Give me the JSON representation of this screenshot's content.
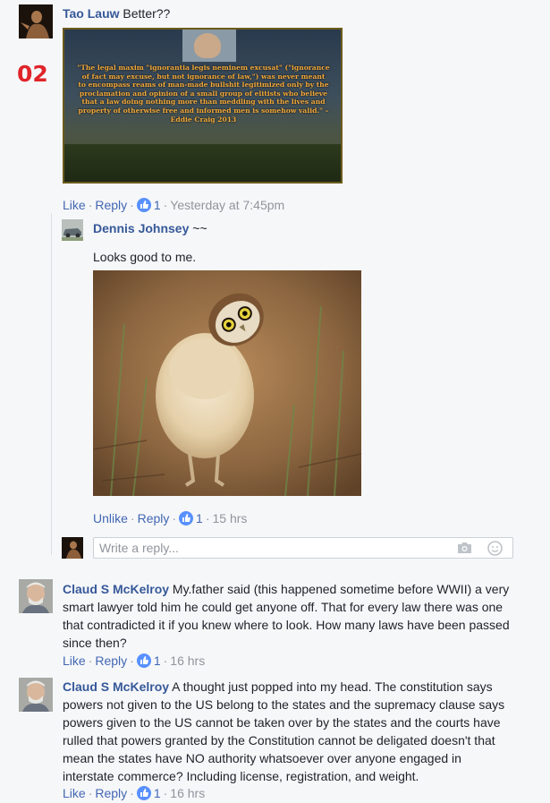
{
  "colors": {
    "link": "#4267b2",
    "author": "#365899",
    "meta": "#90949c",
    "number_mark": "#e0242a",
    "like_badge": "#5890ff"
  },
  "number_mark": "02",
  "thread": {
    "comment1": {
      "author": "Tao Lauw",
      "text": " Better??",
      "image_quote": "\"The legal maxim \"ignorantia legis neminem excusat\" (\"ignorance of fact may excuse, but not ignorance of law,\") was never meant to encompass reams of man-made bullshit legitimized only by the proclamation and opinion of a small group of elitists who believe that a law doing nothing more than meddling with the lives and property of otherwise free and informed men is somehow valid.\" – Eddie Craig 2013",
      "actions": {
        "like": "Like",
        "reply": "Reply",
        "likes": "1",
        "time": "Yesterday at 7:45pm"
      }
    },
    "reply1": {
      "author": "Dennis Johnsey",
      "suffix": " ~~",
      "text": "Looks good to me.",
      "actions": {
        "like": "Unlike",
        "reply": "Reply",
        "likes": "1",
        "time": "15 hrs"
      }
    },
    "reply_input": {
      "placeholder": "Write a reply...",
      "camera_icon": "camera-icon",
      "emoji_icon": "emoji-icon"
    },
    "comment2": {
      "author": "Claud S McKelroy",
      "lines": [
        " My.father said (this happened sometime before WWII) a very",
        "smart lawyer told him he could get anyone off. That for every law there was one",
        "that contradicted it if you knew where to look. How many laws have been passed",
        "since then?"
      ],
      "actions": {
        "like": "Like",
        "reply": "Reply",
        "likes": "1",
        "time": "16 hrs"
      }
    },
    "comment3": {
      "author": "Claud S McKelroy",
      "lines": [
        " A thought just popped into my head. The constitution says",
        "powers not given to the US belong to the states and the supremacy clause says",
        "powers given to the US cannot be taken over by the states and the courts have",
        "rulled that powers granted by the Constitution cannot be deligated doesn't that",
        "mean the states have NO authority whatsoever over anyone engaged in",
        "interstate commerce? Including license, registration, and weight."
      ],
      "actions": {
        "like": "Like",
        "reply": "Reply",
        "likes": "1",
        "time": "16 hrs"
      }
    }
  }
}
